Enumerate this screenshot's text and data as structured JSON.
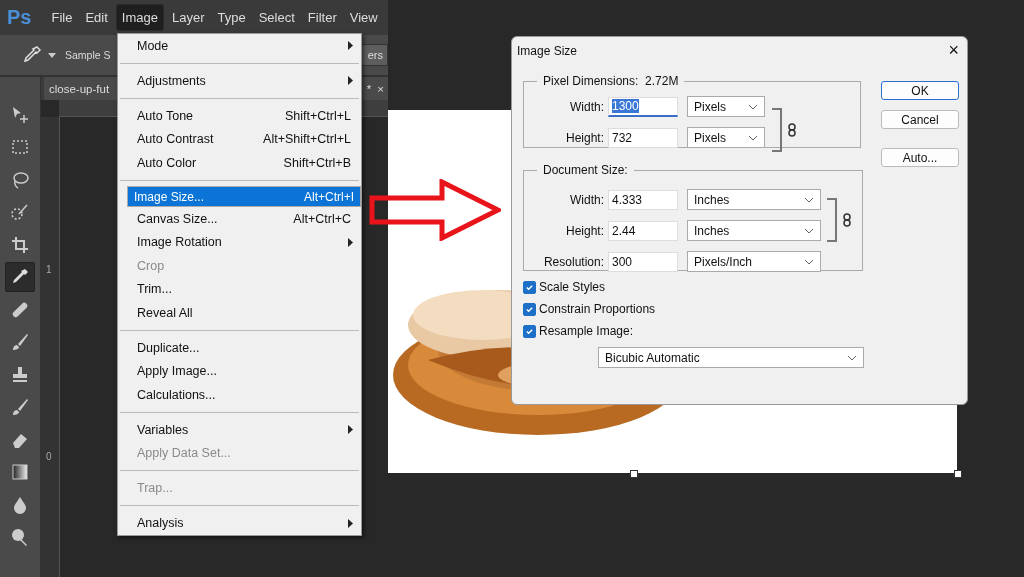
{
  "app": {
    "logo": "Ps"
  },
  "menubar": [
    {
      "label": "File",
      "selected": false
    },
    {
      "label": "Edit",
      "selected": false
    },
    {
      "label": "Image",
      "selected": true
    },
    {
      "label": "Layer",
      "selected": false
    },
    {
      "label": "Type",
      "selected": false
    },
    {
      "label": "Select",
      "selected": false
    },
    {
      "label": "Filter",
      "selected": false
    },
    {
      "label": "View",
      "selected": false
    }
  ],
  "options_bar": {
    "sample_label": "Sample S",
    "right_button": "ers"
  },
  "document_tab": {
    "title": "close-up-fut",
    "modified": "*",
    "close": "×"
  },
  "ruler_labels": [
    "1",
    "0"
  ],
  "tools": [
    {
      "kind": "move",
      "selected": false
    },
    {
      "kind": "marquee",
      "selected": false
    },
    {
      "kind": "lasso",
      "selected": false
    },
    {
      "kind": "quickselect",
      "selected": false
    },
    {
      "kind": "crop",
      "selected": false
    },
    {
      "kind": "eyedropper",
      "selected": true
    },
    {
      "kind": "healing",
      "selected": false
    },
    {
      "kind": "brush",
      "selected": false
    },
    {
      "kind": "stamp",
      "selected": false
    },
    {
      "kind": "historybrush",
      "selected": false
    },
    {
      "kind": "eraser",
      "selected": false
    },
    {
      "kind": "gradient",
      "selected": false
    },
    {
      "kind": "blur",
      "selected": false
    },
    {
      "kind": "dodge",
      "selected": false
    }
  ],
  "image_menu": [
    [
      {
        "label": "Mode",
        "submenu": true,
        "disabled": false,
        "selected": false
      }
    ],
    [
      {
        "label": "Adjustments",
        "submenu": true,
        "disabled": false,
        "selected": false
      }
    ],
    [
      {
        "label": "Auto Tone",
        "shortcut": "Shift+Ctrl+L",
        "submenu": false,
        "disabled": false,
        "selected": false
      },
      {
        "label": "Auto Contrast",
        "shortcut": "Alt+Shift+Ctrl+L",
        "submenu": false,
        "disabled": false,
        "selected": false
      },
      {
        "label": "Auto Color",
        "shortcut": "Shift+Ctrl+B",
        "submenu": false,
        "disabled": false,
        "selected": false
      }
    ],
    [
      {
        "label": "Image Size...",
        "shortcut": "Alt+Ctrl+I",
        "submenu": false,
        "disabled": false,
        "selected": true
      },
      {
        "label": "Canvas Size...",
        "shortcut": "Alt+Ctrl+C",
        "submenu": false,
        "disabled": false,
        "selected": false
      },
      {
        "label": "Image Rotation",
        "submenu": true,
        "disabled": false,
        "selected": false
      },
      {
        "label": "Crop",
        "submenu": false,
        "disabled": true,
        "selected": false
      },
      {
        "label": "Trim...",
        "submenu": false,
        "disabled": false,
        "selected": false
      },
      {
        "label": "Reveal All",
        "submenu": false,
        "disabled": false,
        "selected": false
      }
    ],
    [
      {
        "label": "Duplicate...",
        "submenu": false,
        "disabled": false,
        "selected": false
      },
      {
        "label": "Apply Image...",
        "submenu": false,
        "disabled": false,
        "selected": false
      },
      {
        "label": "Calculations...",
        "submenu": false,
        "disabled": false,
        "selected": false
      }
    ],
    [
      {
        "label": "Variables",
        "submenu": true,
        "disabled": false,
        "selected": false
      },
      {
        "label": "Apply Data Set...",
        "submenu": false,
        "disabled": true,
        "selected": false
      }
    ],
    [
      {
        "label": "Trap...",
        "submenu": false,
        "disabled": true,
        "selected": false
      }
    ],
    [
      {
        "label": "Analysis",
        "submenu": true,
        "disabled": false,
        "selected": false
      }
    ]
  ],
  "dialog": {
    "title": "Image Size",
    "close": "×",
    "pixel_dimensions": {
      "label": "Pixel Dimensions:",
      "value": "2.72M",
      "fields": [
        {
          "label": "Width:",
          "value": "1300",
          "unit": "Pixels",
          "selected": true
        },
        {
          "label": "Height:",
          "value": "732",
          "unit": "Pixels",
          "selected": false
        }
      ]
    },
    "document_size": {
      "label": "Document Size:",
      "fields": [
        {
          "label": "Width:",
          "value": "4.333",
          "unit": "Inches",
          "selected": false
        },
        {
          "label": "Height:",
          "value": "2.44",
          "unit": "Inches",
          "selected": false
        },
        {
          "label": "Resolution:",
          "value": "300",
          "unit": "Pixels/Inch",
          "selected": false
        }
      ]
    },
    "checkboxes": [
      {
        "label": "Scale Styles",
        "checked": true
      },
      {
        "label": "Constrain Proportions",
        "checked": true
      },
      {
        "label": "Resample Image:",
        "checked": true
      }
    ],
    "resample": {
      "value": "Bicubic Automatic"
    },
    "buttons": [
      {
        "label": "OK",
        "default": true
      },
      {
        "label": "Cancel",
        "default": false
      },
      {
        "label": "Auto...",
        "default": false
      }
    ]
  }
}
